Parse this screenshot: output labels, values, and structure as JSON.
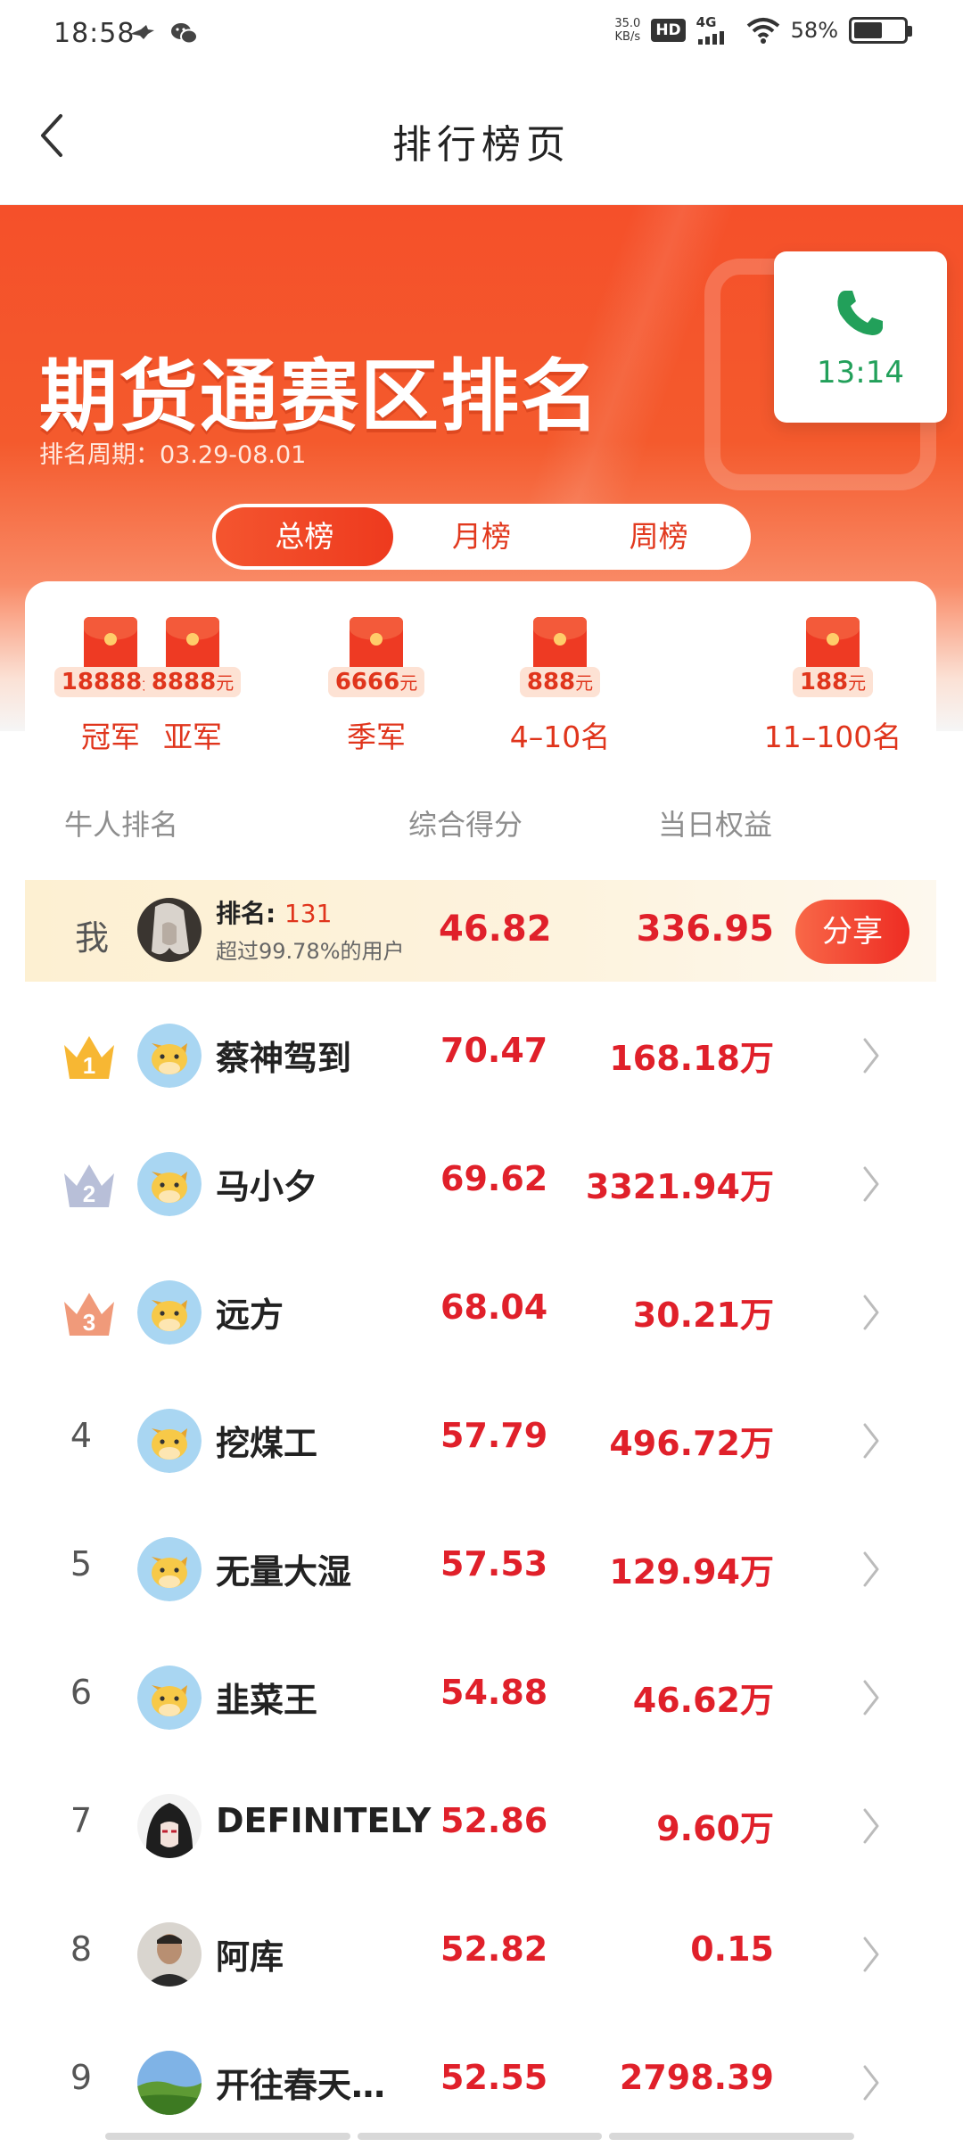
{
  "status_bar": {
    "time": "18:58",
    "net_speed_value": "35.0",
    "net_speed_unit": "KB/s",
    "hd": "HD",
    "network": "4G",
    "battery_pct": "58%",
    "battery_level": 0.58
  },
  "nav": {
    "back_icon": "chevron-left-icon",
    "title": "排行榜页"
  },
  "hero": {
    "title": "期货通赛区排名",
    "period": "排名周期：03.29-08.01",
    "tabs": [
      {
        "label": "总榜",
        "active": true
      },
      {
        "label": "月榜",
        "active": false
      },
      {
        "label": "周榜",
        "active": false
      }
    ]
  },
  "call_widget": {
    "icon": "phone-icon",
    "time": "13:14",
    "color": "#22a05a"
  },
  "prizes": [
    {
      "amount": "18888",
      "unit": "元",
      "name": "冠军"
    },
    {
      "amount": "8888",
      "unit": "元",
      "name": "亚军"
    },
    {
      "amount": "6666",
      "unit": "元",
      "name": "季军"
    },
    {
      "amount": "888",
      "unit": "元",
      "name": "4–10名"
    },
    {
      "amount": "188",
      "unit": "元",
      "name": "11–100名"
    }
  ],
  "columns": {
    "rank": "牛人排名",
    "score": "综合得分",
    "equity": "当日权益"
  },
  "me": {
    "label": "我",
    "rank_label": "排名:",
    "rank_value": "131",
    "beat_text": "超过99.78%的用户",
    "score": "46.82",
    "equity": "336.95",
    "share_label": "分享"
  },
  "ranking": [
    {
      "rank": "1",
      "name": "蔡神驾到",
      "score": "70.47",
      "equity": "168.18万",
      "avatar": "cow-avatar"
    },
    {
      "rank": "2",
      "name": "马小夕",
      "score": "69.62",
      "equity": "3321.94万",
      "avatar": "cow-avatar"
    },
    {
      "rank": "3",
      "name": "远方",
      "score": "68.04",
      "equity": "30.21万",
      "avatar": "cow-avatar"
    },
    {
      "rank": "4",
      "name": "挖煤工",
      "score": "57.79",
      "equity": "496.72万",
      "avatar": "cow-avatar"
    },
    {
      "rank": "5",
      "name": "无量大湿",
      "score": "57.53",
      "equity": "129.94万",
      "avatar": "cow-avatar"
    },
    {
      "rank": "6",
      "name": "韭菜王",
      "score": "54.88",
      "equity": "46.62万",
      "avatar": "cow-avatar"
    },
    {
      "rank": "7",
      "name": "DEFINITELY",
      "score": "52.86",
      "equity": "9.60万",
      "avatar": "anime-avatar"
    },
    {
      "rank": "8",
      "name": "阿库",
      "score": "52.82",
      "equity": "0.15",
      "avatar": "photo-avatar"
    },
    {
      "rank": "9",
      "name": "开往春天…",
      "score": "52.55",
      "equity": "2798.39",
      "avatar": "landscape-avatar"
    }
  ],
  "colors": {
    "accent_red": "#e0202a",
    "hero_orange": "#f5502a",
    "gold": "#f7b733",
    "silver": "#b8bfd8",
    "bronze": "#f09a7a"
  }
}
